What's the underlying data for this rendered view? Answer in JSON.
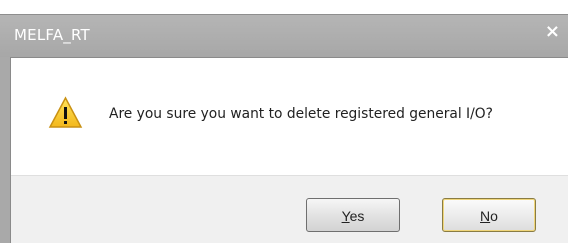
{
  "window": {
    "title": "MELFA_RT",
    "close_glyph": "×"
  },
  "dialog": {
    "message": "Are you sure you want to delete registered general I/O?",
    "icon": "warning-triangle-icon"
  },
  "buttons": {
    "yes": {
      "label": "Yes",
      "mnemonic": "Y",
      "rest": "es"
    },
    "no": {
      "label": "No",
      "mnemonic": "N",
      "rest": "o"
    }
  }
}
